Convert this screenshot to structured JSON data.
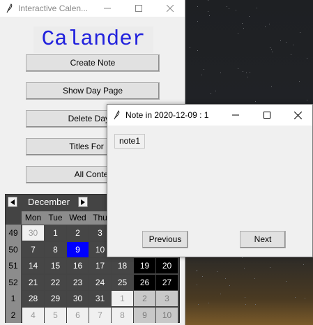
{
  "main_window": {
    "title": "Interactive Calen...",
    "app_title": "Calander",
    "buttons": [
      "Create Note",
      "Show Day Page",
      "Delete Day P",
      "Titles For Pa",
      "All Conter"
    ]
  },
  "calendar": {
    "month": "December",
    "weekdays": [
      "Mon",
      "Tue",
      "Wed",
      "Thu"
    ],
    "weeks": [
      {
        "wk": "49",
        "days": [
          "30",
          "1",
          "2",
          "3",
          "",
          "",
          ""
        ]
      },
      {
        "wk": "50",
        "days": [
          "7",
          "8",
          "9",
          "10",
          "",
          "",
          ""
        ]
      },
      {
        "wk": "51",
        "days": [
          "14",
          "15",
          "16",
          "17",
          "18",
          "19",
          "20"
        ]
      },
      {
        "wk": "52",
        "days": [
          "21",
          "22",
          "23",
          "24",
          "25",
          "26",
          "27"
        ]
      },
      {
        "wk": "1",
        "days": [
          "28",
          "29",
          "30",
          "31",
          "1",
          "2",
          "3"
        ]
      },
      {
        "wk": "2",
        "days": [
          "4",
          "5",
          "6",
          "7",
          "8",
          "9",
          "10"
        ]
      }
    ],
    "selected_day": "9",
    "colors": {
      "selected": "#0000ff",
      "weekend": "#000000",
      "weekday": "#464646"
    }
  },
  "note_window": {
    "title": "Note in 2020-12-09 : 1",
    "note_text": "note1",
    "previous_label": "Previous",
    "next_label": "Next"
  }
}
